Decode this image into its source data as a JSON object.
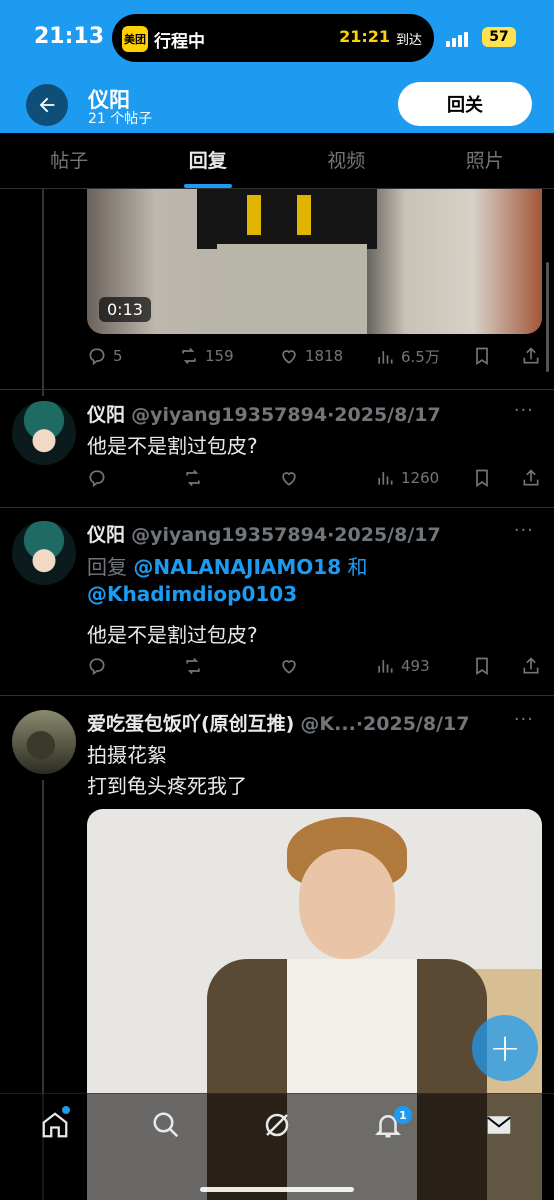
{
  "status_bar": {
    "time": "21:13",
    "island_app": "美团",
    "island_text": "行程中",
    "island_eta": "21:21",
    "island_arrive": "到达",
    "battery": "57"
  },
  "header": {
    "name": "仪阳",
    "post_count": "21 个帖子",
    "follow_label": "回关"
  },
  "tabs": [
    {
      "label": "帖子",
      "active": false
    },
    {
      "label": "回复",
      "active": true
    },
    {
      "label": "视频",
      "active": false
    },
    {
      "label": "照片",
      "active": false
    }
  ],
  "video_post": {
    "duration": "0:13",
    "replies": "5",
    "reposts": "159",
    "likes": "1818",
    "views": "6.5万"
  },
  "tweets": [
    {
      "name": "仪阳",
      "handle": "@yiyang19357894",
      "dot": "·",
      "date": "2025/8/17",
      "text": "他是不是割过包皮?",
      "views": "1260"
    },
    {
      "name": "仪阳",
      "handle": "@yiyang19357894",
      "dot": "·",
      "date": "2025/8/17",
      "reply_prefix": "回复",
      "mention1": "@NALANAJIAMO18",
      "reply_and": "和",
      "mention2": "@Khadimdiop0103",
      "text": "他是不是割过包皮?",
      "views": "493"
    },
    {
      "name": "爱吃蛋包饭吖(原创互推)",
      "handle": "@K...",
      "dot": "·",
      "date": "2025/8/17",
      "line1": "拍摄花絮",
      "line2": "打到龟头疼死我了"
    }
  ],
  "more_glyph": "···",
  "fab_glyph": "+",
  "notifications_badge": "1",
  "icons": [
    "back-arrow-icon",
    "reply-icon",
    "repost-icon",
    "like-icon",
    "views-icon",
    "bookmark-icon",
    "share-icon",
    "home-icon",
    "search-icon",
    "grok-icon",
    "bell-icon",
    "mail-icon"
  ],
  "colors": {
    "accent": "#1d9bf0",
    "background": "#000000",
    "muted": "#71767b"
  }
}
